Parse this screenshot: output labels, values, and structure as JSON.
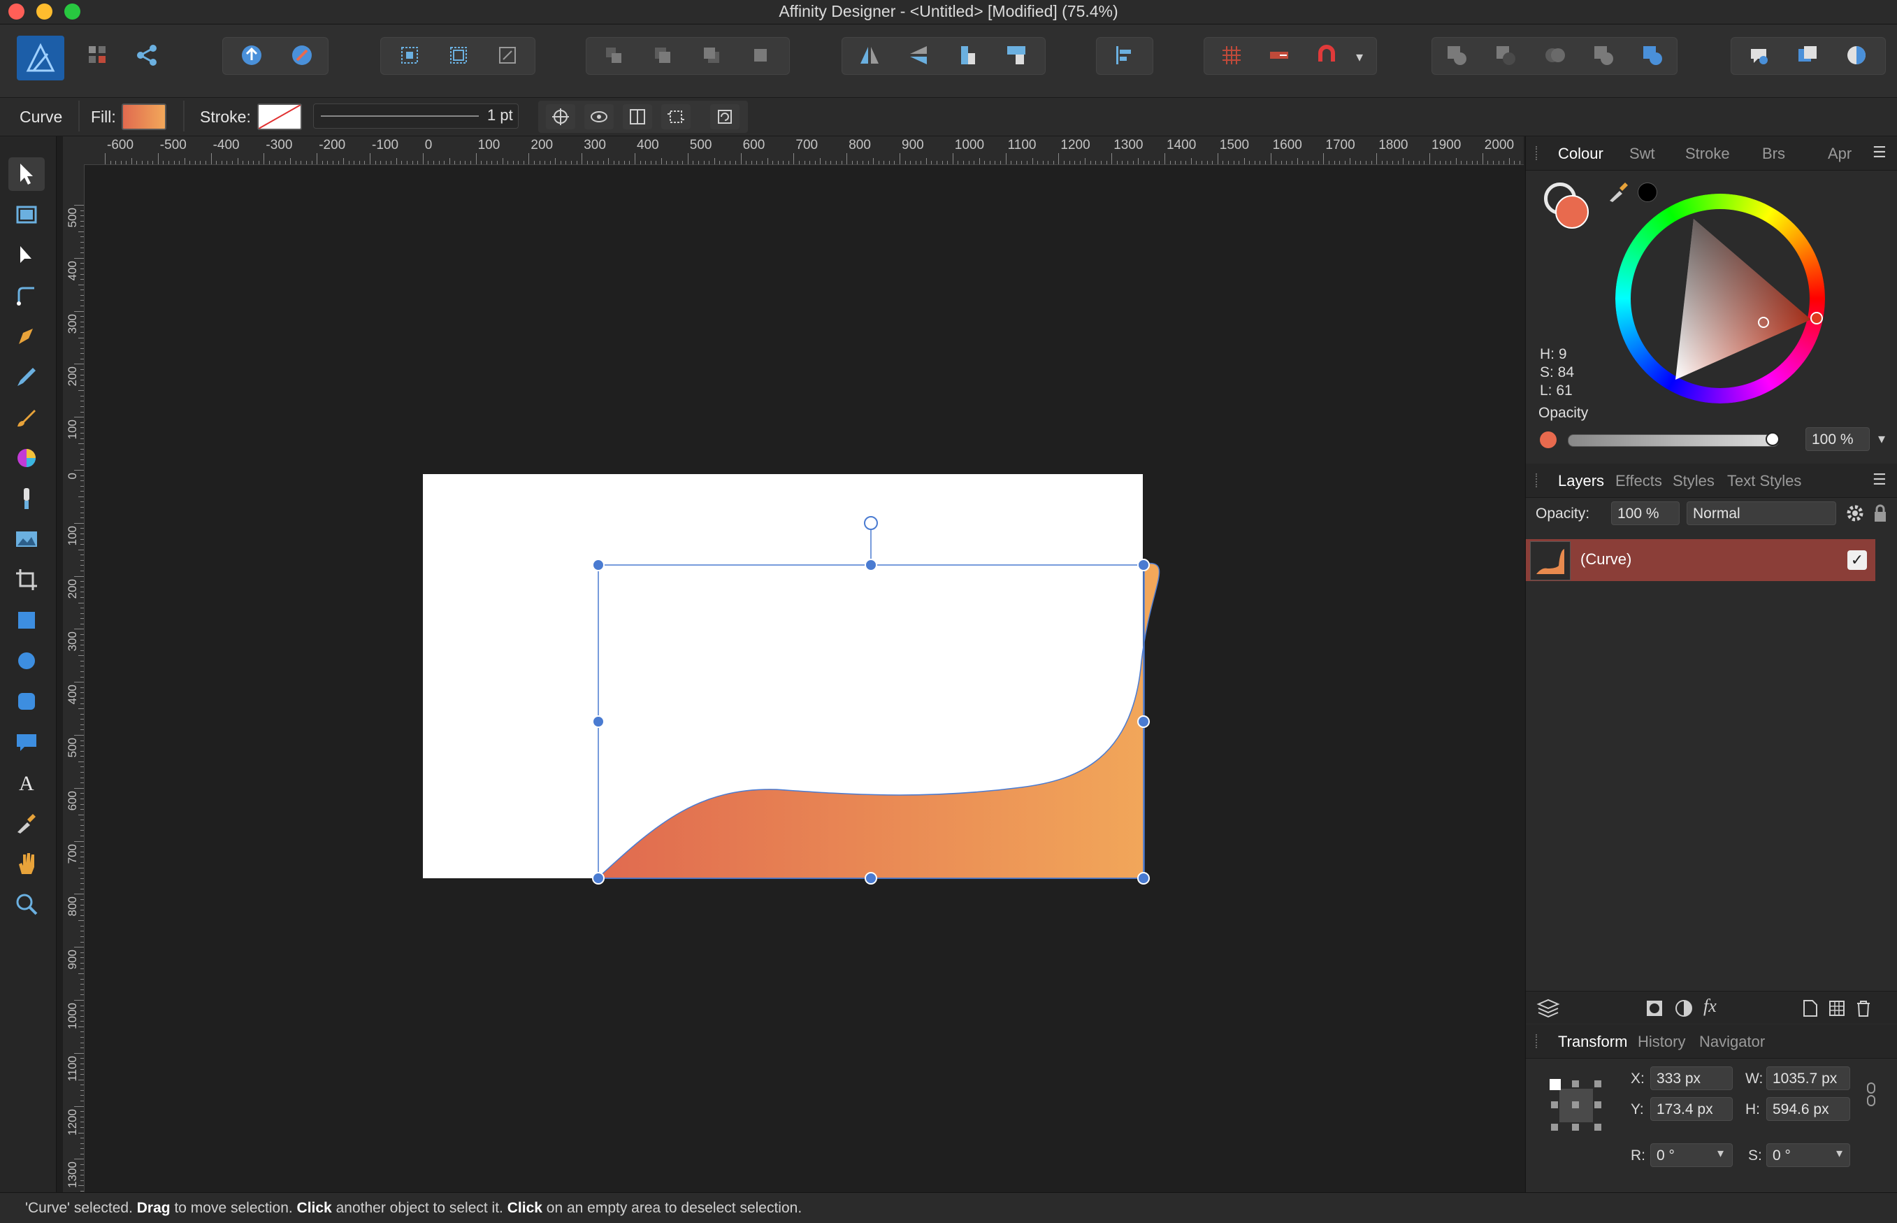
{
  "window": {
    "title": "Affinity Designer - <Untitled> [Modified] (75.4%)"
  },
  "context_bar": {
    "tool_name": "Curve",
    "fill_label": "Fill:",
    "stroke_label": "Stroke:",
    "stroke_width": "1 pt",
    "fill_color_start": "#e06a4f",
    "fill_color_end": "#f2a85a"
  },
  "ruler": {
    "unit": "px",
    "horizontal": [
      "-600",
      "-500",
      "-400",
      "-300",
      "-200",
      "-100",
      "0",
      "100",
      "200",
      "300",
      "400",
      "500",
      "600",
      "700",
      "800",
      "900",
      "1000",
      "1100",
      "1200",
      "1300",
      "1400",
      "1500",
      "1600",
      "1700",
      "1800",
      "1900",
      "2000"
    ],
    "vertical": [
      "500",
      "400",
      "300",
      "200",
      "100",
      "0",
      "100",
      "200",
      "300",
      "400",
      "500",
      "600",
      "700",
      "800",
      "900",
      "1000",
      "1100",
      "1200",
      "1300"
    ]
  },
  "tools": [
    "move-tool-icon",
    "artboard-tool-icon",
    "node-tool-icon",
    "corner-tool-icon",
    "pen-tool-icon",
    "pencil-tool-icon",
    "vector-brush-icon",
    "fill-tool-icon",
    "transparency-tool-icon",
    "place-image-icon",
    "crop-tool-icon",
    "rectangle-tool-icon",
    "ellipse-tool-icon",
    "rounded-rect-tool-icon",
    "speech-bubble-tool-icon",
    "text-tool-icon",
    "color-picker-icon",
    "hand-tool-icon",
    "zoom-tool-icon"
  ],
  "colour_panel": {
    "tabs": [
      "Colour",
      "Swt",
      "Stroke",
      "Brs",
      "Apr"
    ],
    "active_tab": "Colour",
    "h": "H: 9",
    "s": "S: 84",
    "l": "L: 61",
    "opacity_label": "Opacity",
    "opacity_value": "100 %",
    "current_color": "#e86a4e"
  },
  "layers_panel": {
    "tabs": [
      "Layers",
      "Effects",
      "Styles",
      "Text Styles"
    ],
    "active_tab": "Layers",
    "opacity_label": "Opacity:",
    "opacity_value": "100 %",
    "blend_mode": "Normal",
    "layers": [
      {
        "name": "(Curve)",
        "visible": true
      }
    ]
  },
  "transform_panel": {
    "tabs": [
      "Transform",
      "History",
      "Navigator"
    ],
    "active_tab": "Transform",
    "x_label": "X:",
    "x_value": "333 px",
    "y_label": "Y:",
    "y_value": "173.4 px",
    "w_label": "W:",
    "w_value": "1035.7 px",
    "h_label": "H:",
    "h_value": "594.6 px",
    "r_label": "R:",
    "r_value": "0 °",
    "s_label": "S:",
    "s_value": "0 °"
  },
  "status": {
    "part1": "'Curve' selected. ",
    "drag": "Drag",
    "part2": " to move selection. ",
    "click1": "Click",
    "part3": " another object to select it. ",
    "click2": "Click",
    "part4": " on an empty area to deselect selection."
  }
}
